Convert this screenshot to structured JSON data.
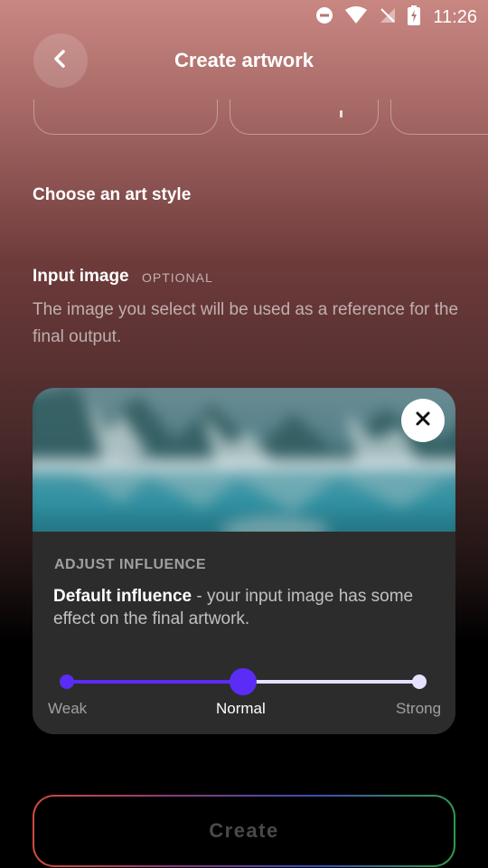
{
  "status_bar": {
    "time": "11:26"
  },
  "header": {
    "title": "Create artwork"
  },
  "sections": {
    "art_style_title": "Choose an art style",
    "input_image_title": "Input image",
    "optional_tag": "OPTIONAL",
    "input_image_description": "The image you select will be used as a reference for the final output."
  },
  "influence": {
    "title": "ADJUST INFLUENCE",
    "description_bold": "Default influence",
    "description_rest": " - your input image has some effect on the final artwork.",
    "levels": [
      "Weak",
      "Normal",
      "Strong"
    ],
    "selected": "Normal"
  },
  "footer": {
    "create_label": "Create"
  },
  "colors": {
    "accent": "#5b2cf5",
    "card": "#2c2c2c"
  }
}
